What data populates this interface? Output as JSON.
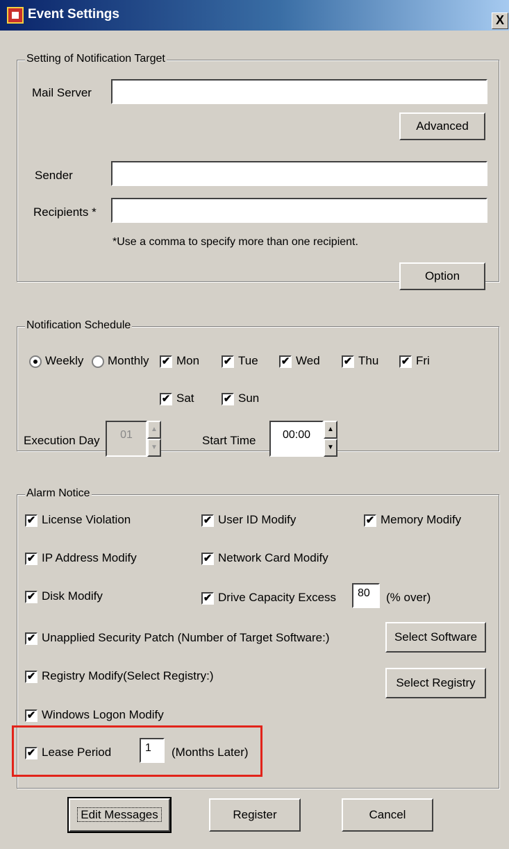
{
  "window": {
    "title": "Event Settings",
    "close_glyph": "X"
  },
  "notification_target": {
    "legend": "Setting of Notification Target",
    "mail_server_label": "Mail Server",
    "mail_server_value": "",
    "advanced_button": "Advanced",
    "sender_label": "Sender",
    "sender_value": "",
    "recipients_label": "Recipients *",
    "recipients_value": "",
    "recipients_hint": "*Use a comma to specify more than one recipient.",
    "option_button": "Option"
  },
  "schedule": {
    "legend": "Notification Schedule",
    "weekly_label": "Weekly",
    "monthly_label": "Monthly",
    "days": [
      {
        "label": "Mon",
        "checked": true
      },
      {
        "label": "Tue",
        "checked": true
      },
      {
        "label": "Wed",
        "checked": true
      },
      {
        "label": "Thu",
        "checked": true
      },
      {
        "label": "Fri",
        "checked": true
      },
      {
        "label": "Sat",
        "checked": true
      },
      {
        "label": "Sun",
        "checked": true
      }
    ],
    "execution_day_label": "Execution Day",
    "execution_day_value": "01",
    "start_time_label": "Start Time",
    "start_time_value": "00:00"
  },
  "alarm": {
    "legend": "Alarm Notice",
    "license_violation": "License Violation",
    "user_id_modify": "User ID Modify",
    "memory_modify": "Memory Modify",
    "ip_address_modify": "IP Address Modify",
    "network_card_modify": "Network Card Modify",
    "disk_modify": "Disk Modify",
    "drive_capacity_excess": "Drive Capacity Excess",
    "drive_capacity_value": "80",
    "drive_capacity_unit": "(% over)",
    "unapplied_patch": "Unapplied Security Patch (Number of Target Software:)",
    "select_software_button": "Select Software",
    "registry_modify": "Registry Modify(Select Registry:)",
    "select_registry_button": "Select Registry",
    "windows_logon_modify": "Windows Logon Modify",
    "lease_period": "Lease Period",
    "lease_period_value": "1",
    "lease_period_unit": "(Months Later)"
  },
  "footer": {
    "edit_messages_button": "Edit Messages",
    "register_button": "Register",
    "cancel_button": "Cancel"
  },
  "glyphs": {
    "check": "✔",
    "spin_up": "▲",
    "spin_down": "▼"
  },
  "colors": {
    "title_bar_start": "#0a246a",
    "highlight_border": "#e2231a",
    "dialog_background": "#d4d0c8"
  }
}
